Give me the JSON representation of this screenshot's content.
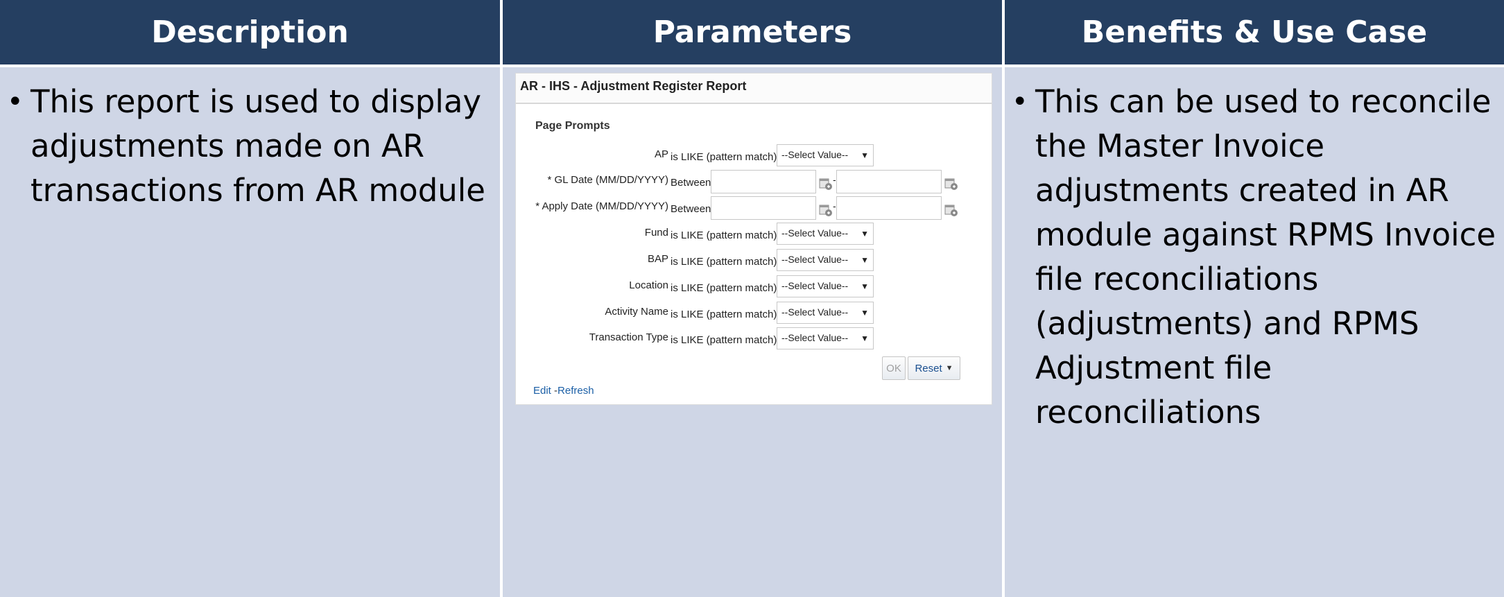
{
  "table": {
    "headers": [
      "Description",
      "Parameters",
      "Benefits & Use Case"
    ],
    "description": "This report is used to display adjustments made on AR transactions from AR module",
    "benefits": "This can be used to reconcile the Master Invoice adjustments created in AR module against RPMS Invoice file reconciliations (adjustments) and RPMS Adjustment file reconciliations",
    "bullet": "•"
  },
  "report": {
    "title": "AR - IHS - Adjustment Register Report",
    "prompts_title": "Page Prompts",
    "rows": [
      {
        "label": "AP",
        "op": "is LIKE (pattern match)",
        "value": "--Select Value--"
      },
      {
        "label": "* GL Date (MM/DD/YYYY)",
        "op": "Between"
      },
      {
        "label": "* Apply Date (MM/DD/YYYY)",
        "op": "Between"
      },
      {
        "label": "Fund",
        "op": "is LIKE (pattern match)",
        "value": "--Select Value--"
      },
      {
        "label": "BAP",
        "op": "is LIKE (pattern match)",
        "value": "--Select Value--"
      },
      {
        "label": "Location",
        "op": "is LIKE (pattern match)",
        "value": "--Select Value--"
      },
      {
        "label": "Activity Name",
        "op": "is LIKE (pattern match)",
        "value": "--Select Value--"
      },
      {
        "label": "Transaction Type",
        "op": "is LIKE (pattern match)",
        "value": "--Select Value--"
      }
    ],
    "date_dash": "-",
    "ok_label": "OK",
    "reset_label": "Reset",
    "reset_arrow": "▼",
    "select_arrow": "▼",
    "edit_link": "Edit",
    "link_sep": "-",
    "refresh_link": "Refresh"
  },
  "colors": {
    "header_bg": "#253f61",
    "cell_bg": "#cfd6e6",
    "link": "#1b5fa6"
  },
  "icons": [
    "calendar-icon",
    "dropdown-arrow-icon"
  ]
}
